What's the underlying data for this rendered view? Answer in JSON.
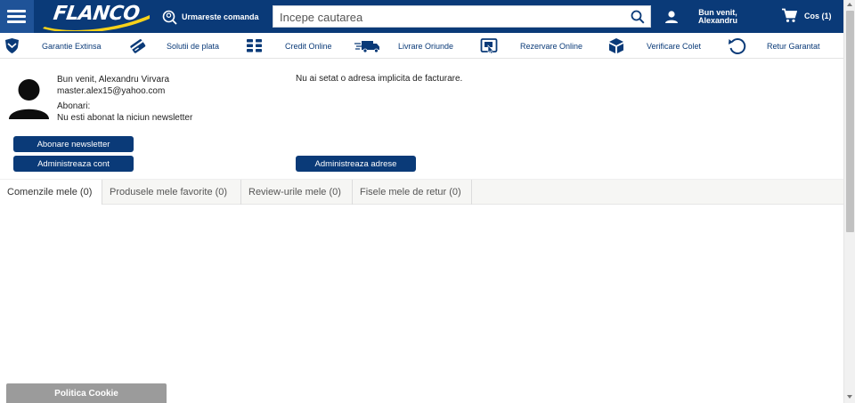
{
  "header": {
    "logo_text": "FLANCO",
    "track_order_label": "Urmareste comanda",
    "search_placeholder": "Incepe cautarea",
    "user_greeting_line1": "Bun venit,",
    "user_greeting_line2": "Alexandru",
    "cart_label": "Cos (1)"
  },
  "nav": {
    "items": [
      {
        "label": "Garantie Extinsa",
        "icon": "shield-icon"
      },
      {
        "label": "Solutii de plata",
        "icon": "card-icon"
      },
      {
        "label": "Credit Online",
        "icon": "money-icon"
      },
      {
        "label": "Livrare Oriunde",
        "icon": "truck-icon"
      },
      {
        "label": "Rezervare Online",
        "icon": "reserve-icon"
      },
      {
        "label": "Verificare Colet",
        "icon": "box-icon"
      },
      {
        "label": "Retur Garantat",
        "icon": "return-icon"
      }
    ]
  },
  "account": {
    "welcome": "Bun venit, Alexandru Virvara",
    "email": "master.alex15@yahoo.com",
    "subscriptions_label": "Abonari:",
    "subscriptions_value": "Nu esti abonat la niciun newsletter",
    "no_address": "Nu ai setat o adresa implicita de facturare.",
    "newsletter_button": "Abonare newsletter",
    "manage_account_button": "Administreaza cont",
    "manage_addresses_button": "Administreaza adrese"
  },
  "tabs": [
    {
      "label": "Comenzile mele (0)",
      "active": true
    },
    {
      "label": "Produsele mele favorite (0)",
      "active": false
    },
    {
      "label": "Review-urile mele (0)",
      "active": false
    },
    {
      "label": "Fisele mele de retur (0)",
      "active": false
    }
  ],
  "cookie_label": "Politica Cookie",
  "colors": {
    "brand_blue": "#0a3a78",
    "burger_blue": "#1f5398",
    "logo_yellow": "#f7d21a",
    "cookie_gray": "#9b9b9b"
  }
}
